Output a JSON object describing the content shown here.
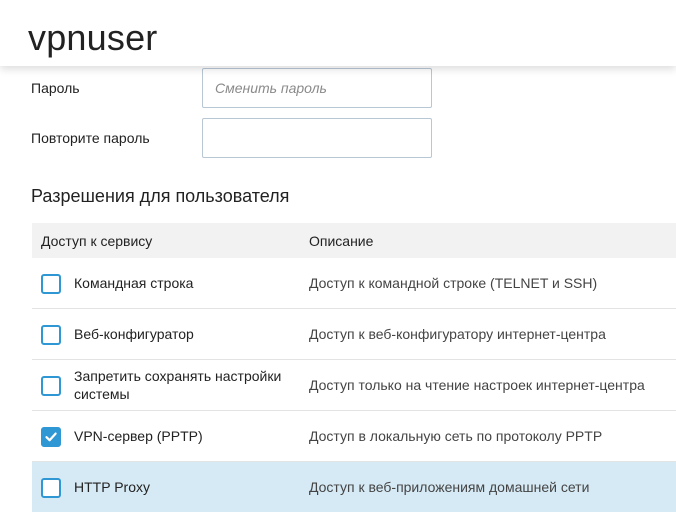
{
  "header": {
    "title": "vpnuser"
  },
  "form": {
    "password_label": "Пароль",
    "password_value": "",
    "password_placeholder": "Сменить пароль",
    "repeat_label": "Повторите пароль",
    "repeat_value": "",
    "repeat_placeholder": ""
  },
  "permissions": {
    "title": "Разрешения для пользователя",
    "columns": {
      "service": "Доступ к сервису",
      "description": "Описание"
    },
    "rows": [
      {
        "label": "Командная строка",
        "description": "Доступ к командной строке (TELNET и SSH)",
        "checked": false,
        "highlighted": false
      },
      {
        "label": "Веб-конфигуратор",
        "description": "Доступ к веб-конфигуратору интернет-центра",
        "checked": false,
        "highlighted": false
      },
      {
        "label": "Запретить сохранять настройки системы",
        "description": "Доступ только на чтение настроек интернет-центра",
        "checked": false,
        "highlighted": false
      },
      {
        "label": "VPN-сервер (PPTP)",
        "description": "Доступ в локальную сеть по протоколу PPTP",
        "checked": true,
        "highlighted": false
      },
      {
        "label": "HTTP Proxy",
        "description": "Доступ к веб-приложениям домашней сети",
        "checked": false,
        "highlighted": true
      }
    ]
  },
  "colors": {
    "accent": "#2f97d3",
    "highlight_row": "#d6eaf5",
    "table_header": "#f2f2f2",
    "input_border": "#b7c7d4"
  },
  "icons": {
    "checkmark": "checkmark-icon"
  }
}
